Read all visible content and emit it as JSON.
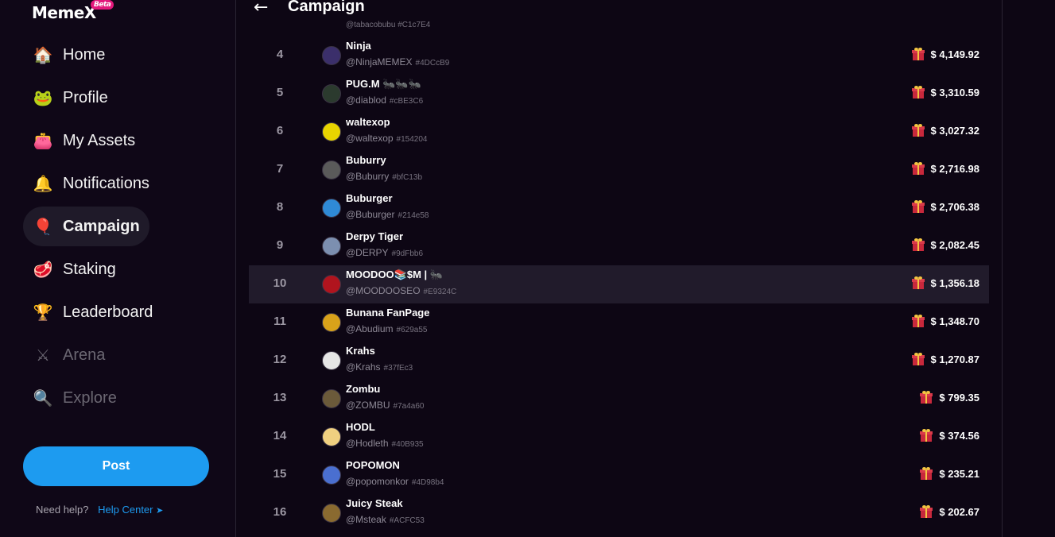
{
  "app": {
    "logo": "MemeX",
    "beta_badge": "Beta"
  },
  "sidebar": {
    "items": [
      {
        "label": "Home",
        "icon": "house-icon",
        "glyph": "🏠",
        "state": "normal"
      },
      {
        "label": "Profile",
        "icon": "pepe-face-icon",
        "glyph": "🐸",
        "state": "normal"
      },
      {
        "label": "My Assets",
        "icon": "wallet-icon",
        "glyph": "👛",
        "state": "normal"
      },
      {
        "label": "Notifications",
        "icon": "bell-icon",
        "glyph": "🔔",
        "state": "normal"
      },
      {
        "label": "Campaign",
        "icon": "balloon-icon",
        "glyph": "🎈",
        "state": "active"
      },
      {
        "label": "Staking",
        "icon": "meat-icon",
        "glyph": "🥩",
        "state": "normal"
      },
      {
        "label": "Leaderboard",
        "icon": "podium-icon",
        "glyph": "🏆",
        "state": "normal"
      },
      {
        "label": "Arena",
        "icon": "crossed-swords-icon",
        "glyph": "⚔",
        "state": "disabled"
      },
      {
        "label": "Explore",
        "icon": "magnifier-icon",
        "glyph": "🔍",
        "state": "disabled"
      }
    ],
    "post_label": "Post",
    "help_text": "Need help?",
    "help_link": "Help Center"
  },
  "header": {
    "title": "Campaign",
    "back_icon": "arrow-left-icon"
  },
  "leaderboard": {
    "partial_row": {
      "handle": "@tabacobubu",
      "tag": "#C1c7E4"
    },
    "rows": [
      {
        "rank": "4",
        "name": "Ninja",
        "handle": "@NinjaMEMEX",
        "tag": "#4DCcB9",
        "amount": "$ 4,149.92",
        "avatar_color": "#3b2f6b",
        "highlight": false
      },
      {
        "rank": "5",
        "name": "PUG.M 🐜🐜🐜",
        "handle": "@diablod",
        "tag": "#cBE3C6",
        "amount": "$ 3,310.59",
        "avatar_color": "#2b3a2e",
        "highlight": false
      },
      {
        "rank": "6",
        "name": "waltexop",
        "handle": "@waltexop",
        "tag": "#154204",
        "amount": "$ 3,027.32",
        "avatar_color": "#e8d400",
        "highlight": false
      },
      {
        "rank": "7",
        "name": "Buburry",
        "handle": "@Buburry",
        "tag": "#bfC13b",
        "amount": "$ 2,716.98",
        "avatar_color": "#5a5a5a",
        "highlight": false
      },
      {
        "rank": "8",
        "name": "Buburger",
        "handle": "@Buburger",
        "tag": "#214e58",
        "amount": "$ 2,706.38",
        "avatar_color": "#2f8ad6",
        "highlight": false
      },
      {
        "rank": "9",
        "name": "Derpy Tiger",
        "handle": "@DERPY",
        "tag": "#9dFbb6",
        "amount": "$ 2,082.45",
        "avatar_color": "#7c8fb0",
        "highlight": false
      },
      {
        "rank": "10",
        "name": "MOODOO📚$M | 🐜",
        "handle": "@MOODOOSEO",
        "tag": "#E9324C",
        "amount": "$ 1,356.18",
        "avatar_color": "#b0141e",
        "highlight": true
      },
      {
        "rank": "11",
        "name": "Bunana FanPage",
        "handle": "@Abudium",
        "tag": "#629a55",
        "amount": "$ 1,348.70",
        "avatar_color": "#d9a21a",
        "highlight": false
      },
      {
        "rank": "12",
        "name": "Krahs",
        "handle": "@Krahs",
        "tag": "#37fEc3",
        "amount": "$ 1,270.87",
        "avatar_color": "#e6e6e6",
        "highlight": false
      },
      {
        "rank": "13",
        "name": "Zombu",
        "handle": "@ZOMBU",
        "tag": "#7a4a60",
        "amount": "$ 799.35",
        "avatar_color": "#6b5a3a",
        "highlight": false
      },
      {
        "rank": "14",
        "name": "HODL",
        "handle": "@Hodleth",
        "tag": "#40B935",
        "amount": "$ 374.56",
        "avatar_color": "#f0d080",
        "highlight": false
      },
      {
        "rank": "15",
        "name": "POPOMON",
        "handle": "@popomonkor",
        "tag": "#4D98b4",
        "amount": "$ 235.21",
        "avatar_color": "#4a6fd0",
        "highlight": false
      },
      {
        "rank": "16",
        "name": "Juicy Steak",
        "handle": "@Msteak",
        "tag": "#ACFC53",
        "amount": "$ 202.67",
        "avatar_color": "#8a6a30",
        "highlight": false
      }
    ]
  }
}
